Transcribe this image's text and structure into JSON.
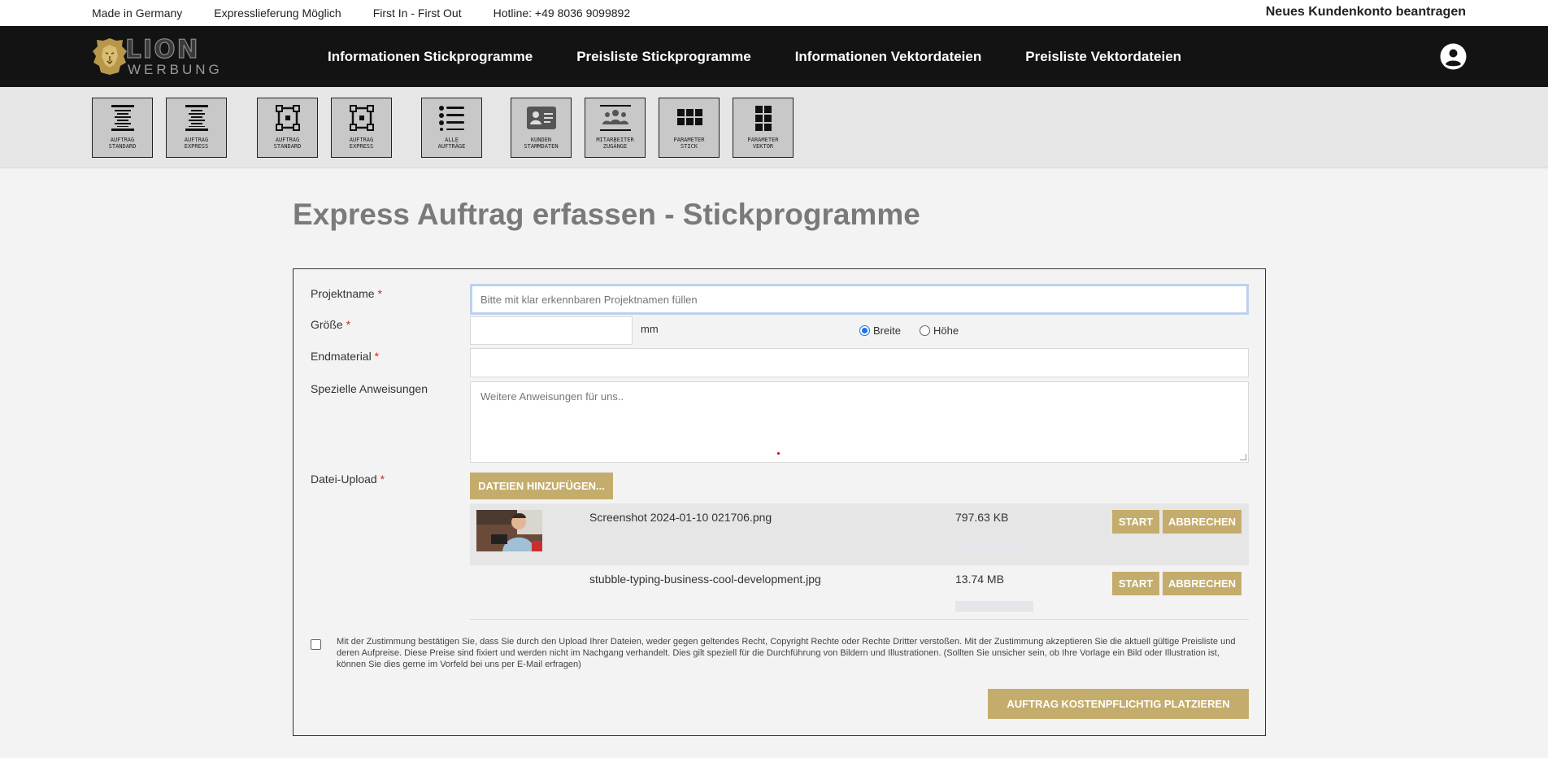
{
  "topbar": {
    "links": [
      "Made in Germany",
      "Expresslieferung Möglich",
      "First In - First Out",
      "Hotline: +49 8036 9099892"
    ],
    "account_link": "Neues Kundenkonto beantragen"
  },
  "brand": {
    "word1": "LION",
    "word2": "WERBUNG"
  },
  "nav": [
    "Informationen Stickprogramme",
    "Preisliste Stickprogramme",
    "Informationen Vektordateien",
    "Preisliste Vektordateien"
  ],
  "toolbar": [
    {
      "label": "AUFTRAG\nSTANDARD",
      "icon": "spool-icon"
    },
    {
      "label": "AUFTRAG\nEXPRESS",
      "icon": "spool-express-icon"
    },
    {
      "label": "AUFTRAG\nSTANDARD",
      "icon": "vector-nodes-icon"
    },
    {
      "label": "AUFTRAG\nEXPRESS",
      "icon": "vector-nodes-express-icon"
    },
    {
      "label": "ALLE\nAUFTRÄGE",
      "icon": "list-icon"
    },
    {
      "label": "KUNDEN\nSTAMMDATEN",
      "icon": "contact-card-icon"
    },
    {
      "label": "MITARBEITER\nZUGÄNGE",
      "icon": "team-icon"
    },
    {
      "label": "PARAMETER\nSTICK",
      "icon": "grid-icon"
    },
    {
      "label": "PARAMETER\nVEKTOR",
      "icon": "grid-vertical-icon"
    }
  ],
  "page_title": "Express Auftrag erfassen - Stickprogramme",
  "form": {
    "project_label": "Projektname",
    "project_placeholder": "Bitte mit klar erkennbaren Projektnamen füllen",
    "size_label": "Größe",
    "size_value": "",
    "size_unit": "mm",
    "radio_width": "Breite",
    "radio_height": "Höhe",
    "radio_selected": "Breite",
    "material_label": "Endmaterial",
    "material_value": "",
    "instructions_label": "Spezielle Anweisungen",
    "instructions_placeholder": "Weitere Anweisungen für uns..",
    "upload_label": "Datei-Upload",
    "add_files_button": "DATEIEN HINZUFÜGEN...",
    "required_marker": "*",
    "files": [
      {
        "name": "Screenshot 2024-01-10 021706.png",
        "size": "797.63 KB",
        "progress": 0,
        "has_thumbnail": true
      },
      {
        "name": "stubble-typing-business-cool-development.jpg",
        "size": "13.74 MB",
        "progress": 0,
        "has_thumbnail": false
      }
    ],
    "start_button": "START",
    "cancel_button": "ABBRECHEN",
    "consent_text": "Mit der Zustimmung bestätigen Sie, dass Sie durch den Upload Ihrer Dateien, weder gegen geltendes Recht, Copyright Rechte oder Rechte Dritter verstoßen. Mit der Zustimmung akzeptieren Sie die aktuell gültige Preisliste und deren Aufpreise. Diese Preise sind fixiert und werden nicht im Nachgang verhandelt. Dies gilt speziell für die Durchführung von Bildern und Illustrationen. (Sollten Sie unsicher sein, ob Ihre Vorlage ein Bild oder Illustration ist, können Sie dies gerne im Vorfeld bei uns per E-Mail erfragen)",
    "consent_checked": false,
    "submit_button": "AUFTRAG KOSTENPFLICHTIG PLATZIEREN"
  },
  "colors": {
    "accent": "#c4ad6c",
    "nav_bg": "#131313",
    "title": "#7a7a7a"
  }
}
